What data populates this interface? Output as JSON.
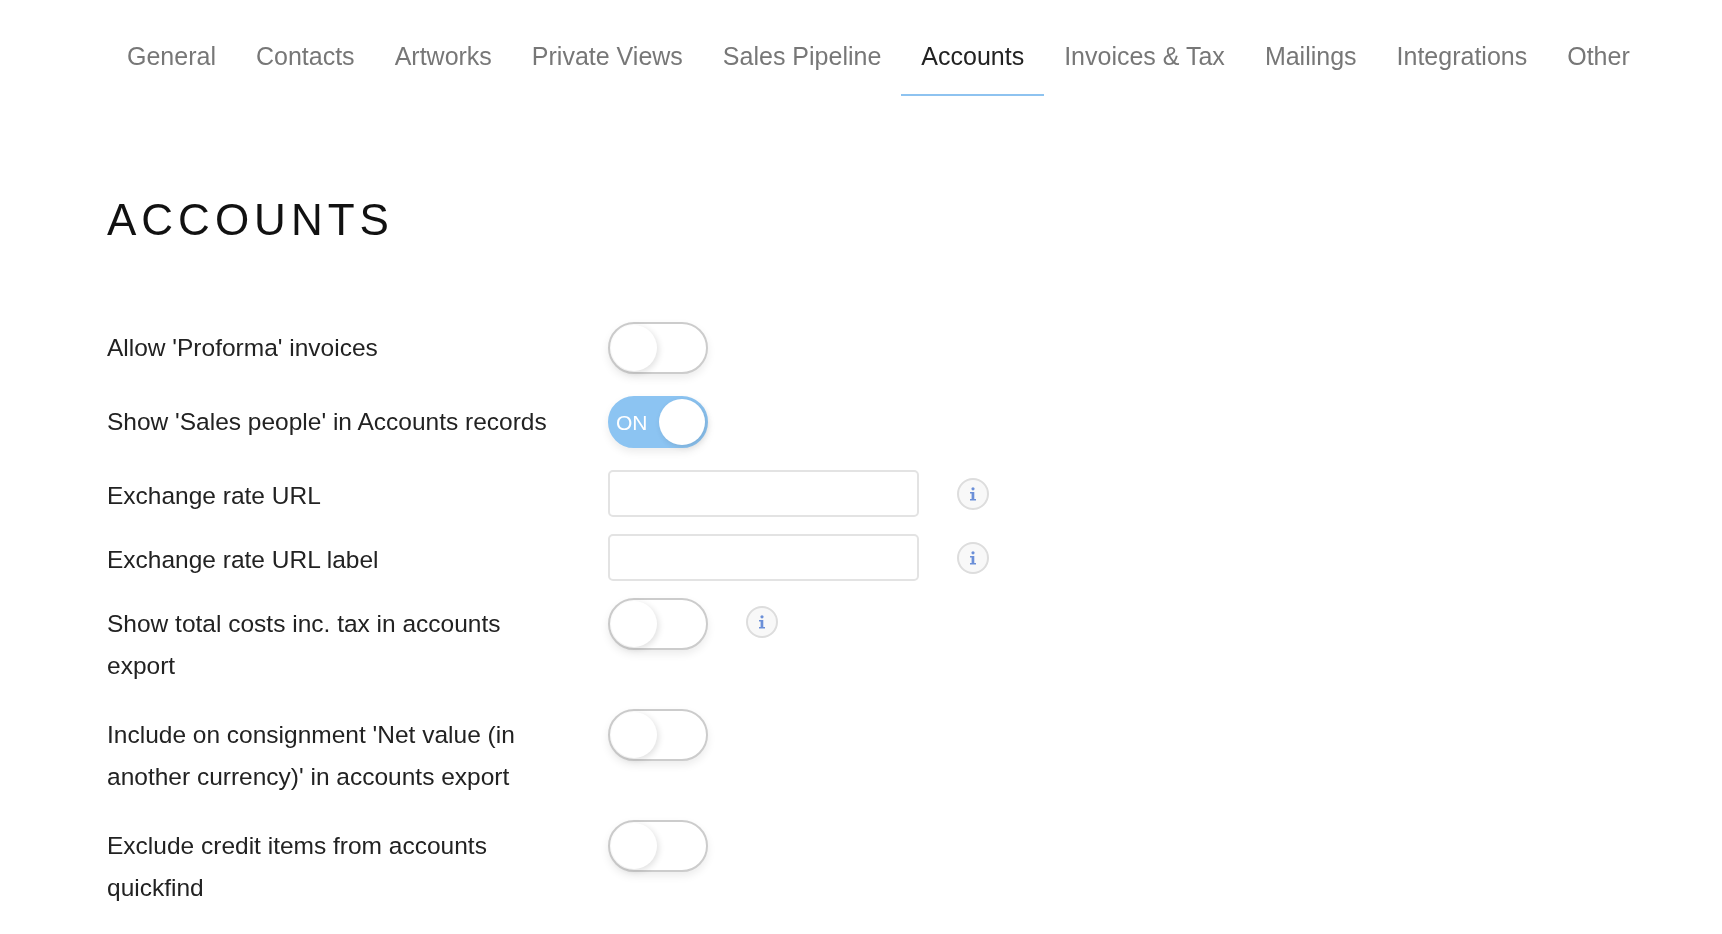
{
  "tabs": [
    {
      "label": "General",
      "selected": false
    },
    {
      "label": "Contacts",
      "selected": false
    },
    {
      "label": "Artworks",
      "selected": false
    },
    {
      "label": "Private Views",
      "selected": false
    },
    {
      "label": "Sales Pipeline",
      "selected": false
    },
    {
      "label": "Accounts",
      "selected": true
    },
    {
      "label": "Invoices & Tax",
      "selected": false
    },
    {
      "label": "Mailings",
      "selected": false
    },
    {
      "label": "Integrations",
      "selected": false
    },
    {
      "label": "Other",
      "selected": false
    }
  ],
  "heading": "ACCOUNTS",
  "settings": [
    {
      "kind": "toggle",
      "label": "Allow 'Proforma' invoices",
      "on": false,
      "info": false
    },
    {
      "kind": "toggle",
      "label": "Show 'Sales people' in Accounts records",
      "on": true,
      "on_text": "ON",
      "info": false
    },
    {
      "kind": "input",
      "label": "Exchange rate URL",
      "info": true
    },
    {
      "kind": "input",
      "label": "Exchange rate URL label",
      "info": true
    },
    {
      "kind": "toggle",
      "label": "Show total costs inc. tax in accounts export",
      "on": false,
      "info": true
    },
    {
      "kind": "toggle",
      "label": "Include on consignment 'Net value (in another currency)' in accounts export",
      "on": false,
      "info": false
    },
    {
      "kind": "toggle",
      "label": "Exclude credit items from accounts quickfind",
      "on": false,
      "info": false
    }
  ]
}
